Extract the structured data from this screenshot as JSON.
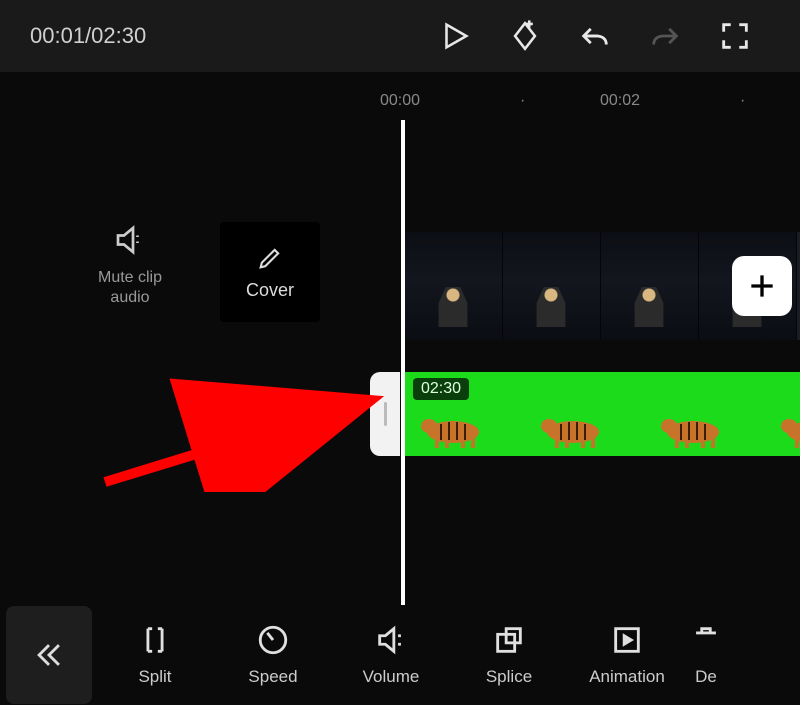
{
  "header": {
    "time_display": "00:01/02:30"
  },
  "ruler": {
    "t0": "00:00",
    "t1": "00:02"
  },
  "left_panel": {
    "mute_label": "Mute clip audio",
    "cover_label": "Cover"
  },
  "track2": {
    "duration_badge": "02:30"
  },
  "toolbar": {
    "split": "Split",
    "speed": "Speed",
    "volume": "Volume",
    "splice": "Splice",
    "animation": "Animation",
    "delete_partial": "De"
  }
}
